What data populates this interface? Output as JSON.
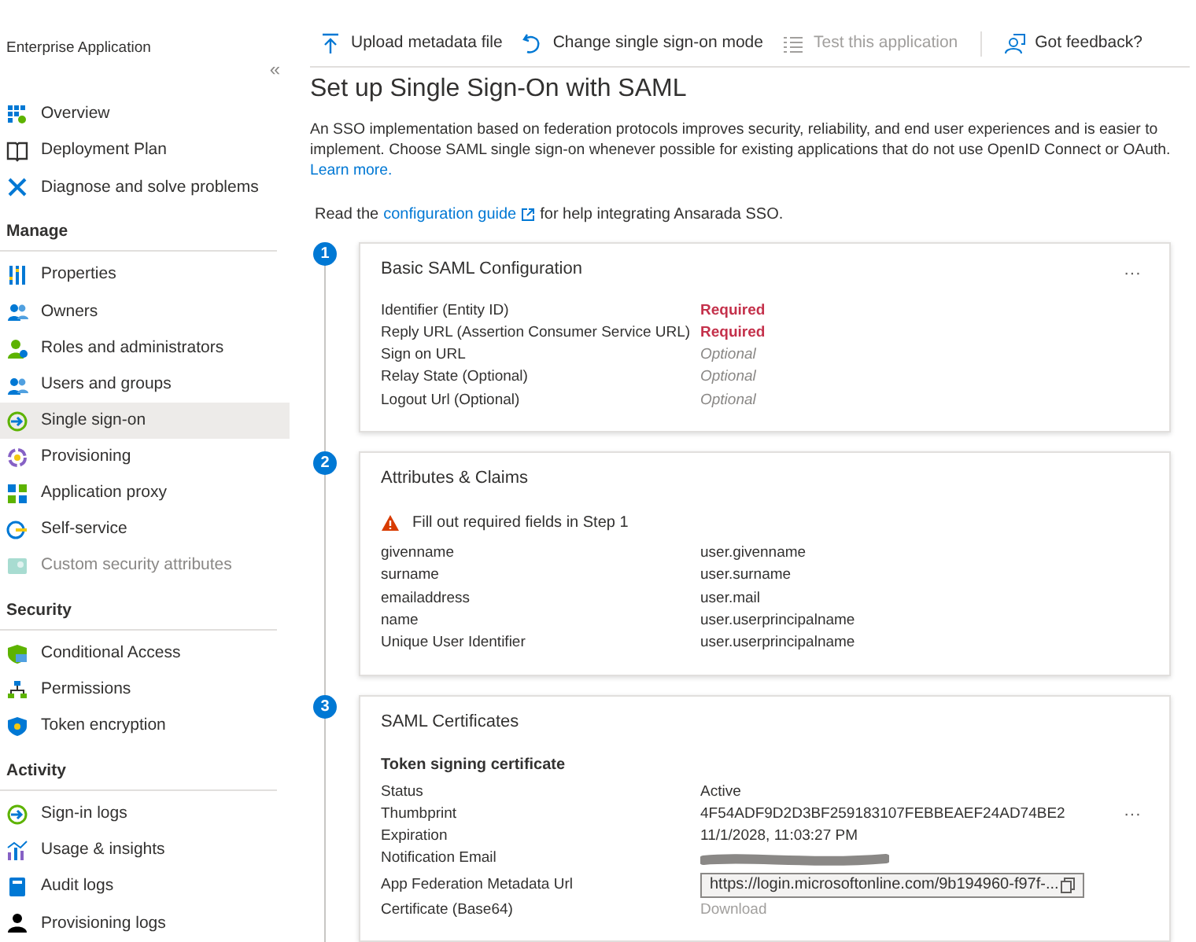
{
  "breadcrumb": "Enterprise Application",
  "sidebar": {
    "collapse": "«",
    "sections": [
      {
        "items": [
          {
            "label": "Overview",
            "selected": false,
            "disabled": false
          },
          {
            "label": "Deployment Plan",
            "selected": false,
            "disabled": false
          },
          {
            "label": "Diagnose and solve problems",
            "selected": false,
            "disabled": false
          }
        ]
      },
      {
        "heading": "Manage",
        "items": [
          {
            "label": "Properties",
            "selected": false,
            "disabled": false
          },
          {
            "label": "Owners",
            "selected": false,
            "disabled": false
          },
          {
            "label": "Roles and administrators",
            "selected": false,
            "disabled": false
          },
          {
            "label": "Users and groups",
            "selected": false,
            "disabled": false
          },
          {
            "label": "Single sign-on",
            "selected": true,
            "disabled": false
          },
          {
            "label": "Provisioning",
            "selected": false,
            "disabled": false
          },
          {
            "label": "Application proxy",
            "selected": false,
            "disabled": false
          },
          {
            "label": "Self-service",
            "selected": false,
            "disabled": false
          },
          {
            "label": "Custom security attributes",
            "selected": false,
            "disabled": true
          }
        ]
      },
      {
        "heading": "Security",
        "items": [
          {
            "label": "Conditional Access",
            "selected": false,
            "disabled": false
          },
          {
            "label": "Permissions",
            "selected": false,
            "disabled": false
          },
          {
            "label": "Token encryption",
            "selected": false,
            "disabled": false
          }
        ]
      },
      {
        "heading": "Activity",
        "items": [
          {
            "label": "Sign-in logs",
            "selected": false,
            "disabled": false
          },
          {
            "label": "Usage & insights",
            "selected": false,
            "disabled": false
          },
          {
            "label": "Audit logs",
            "selected": false,
            "disabled": false
          },
          {
            "label": "Provisioning logs",
            "selected": false,
            "disabled": false
          }
        ]
      }
    ]
  },
  "toolbar": [
    {
      "label": "Upload metadata file",
      "disabled": false
    },
    {
      "label": "Change single sign-on mode",
      "disabled": false
    },
    {
      "label": "Test this application",
      "disabled": true
    },
    {
      "label": "Got feedback?",
      "disabled": false
    }
  ],
  "title": "Set up Single Sign-On with SAML",
  "intro": {
    "text": "An SSO implementation based on federation protocols improves security, reliability, and end user experiences and is easier to implement. Choose SAML single sign-on whenever possible for existing applications that do not use OpenID Connect or OAuth.",
    "link": "Learn more."
  },
  "guide": {
    "before": "Read the",
    "link": "configuration guide",
    "after": "for help integrating Ansarada SSO."
  },
  "steps": [
    {
      "number": "1",
      "title": "Basic SAML Configuration",
      "more": "···",
      "rows": [
        {
          "label": "Identifier (Entity ID)",
          "value": "Required",
          "kind": "required"
        },
        {
          "label": "Reply URL (Assertion Consumer Service URL)",
          "value": "Required",
          "kind": "required"
        },
        {
          "label": "Sign on URL",
          "value": "Optional",
          "kind": "optional"
        },
        {
          "label": "Relay State (Optional)",
          "value": "Optional",
          "kind": "optional"
        },
        {
          "label": "Logout Url (Optional)",
          "value": "Optional",
          "kind": "optional"
        }
      ]
    },
    {
      "number": "2",
      "title": "Attributes & Claims",
      "warning": "Fill out required fields in Step 1",
      "rows": [
        {
          "label": "givenname",
          "value": "user.givenname",
          "kind": "text"
        },
        {
          "label": "surname",
          "value": "user.surname",
          "kind": "text"
        },
        {
          "label": "emailaddress",
          "value": "user.mail",
          "kind": "text"
        },
        {
          "label": "name",
          "value": "user.userprincipalname",
          "kind": "text"
        },
        {
          "label": "Unique User Identifier",
          "value": "user.userprincipalname",
          "kind": "text"
        }
      ]
    },
    {
      "number": "3",
      "title": "SAML Certificates",
      "more": "···",
      "subtitle": "Token signing certificate",
      "rows": [
        {
          "label": "Status",
          "value": "Active",
          "kind": "text"
        },
        {
          "label": "Thumbprint",
          "value": "4F54ADF9D2D3BF259183107FEBBEAEF24AD74BE2",
          "kind": "text"
        },
        {
          "label": "Expiration",
          "value": "11/1/2028, 11:03:27 PM",
          "kind": "text"
        },
        {
          "label": "Notification Email",
          "kind": "redacted"
        },
        {
          "label": "App Federation Metadata Url",
          "value": "https://login.microsoftonline.com/9b194960-f97f-...",
          "kind": "url"
        },
        {
          "label": "Certificate (Base64)",
          "value": "Download",
          "kind": "link"
        }
      ]
    }
  ]
}
